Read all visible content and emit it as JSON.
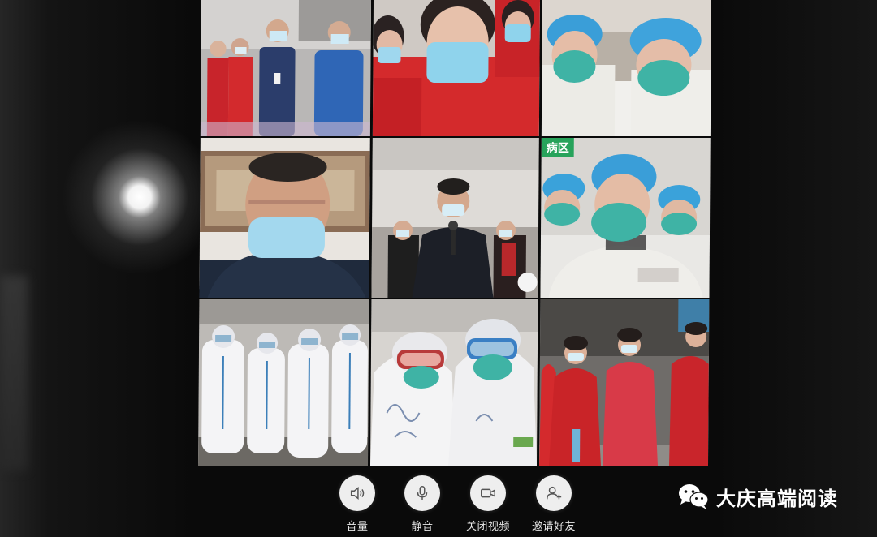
{
  "tiles": [
    {
      "name": "video-tile-1"
    },
    {
      "name": "video-tile-2"
    },
    {
      "name": "video-tile-3"
    },
    {
      "name": "video-tile-4"
    },
    {
      "name": "video-tile-5"
    },
    {
      "name": "video-tile-6",
      "tag": "病区"
    },
    {
      "name": "video-tile-7"
    },
    {
      "name": "video-tile-8"
    },
    {
      "name": "video-tile-9"
    }
  ],
  "controls": {
    "volume": {
      "label": "音量",
      "icon": "speaker-icon"
    },
    "mute": {
      "label": "静音",
      "icon": "microphone-icon"
    },
    "video_off": {
      "label": "关闭视频",
      "icon": "camera-icon"
    },
    "invite": {
      "label": "邀请好友",
      "icon": "add-person-icon"
    }
  },
  "watermark": {
    "brand": "大庆高端阅读",
    "icon": "wechat-icon"
  },
  "colors": {
    "control_bg": "#eeeeee",
    "control_label": "#e8e8e8",
    "tag_green": "#27a35b",
    "mask_blue": "#8fd3ec",
    "mask_teal": "#3fb3a5",
    "red_jacket": "#d8232a",
    "scrub_cap": "#3a9ed8"
  }
}
